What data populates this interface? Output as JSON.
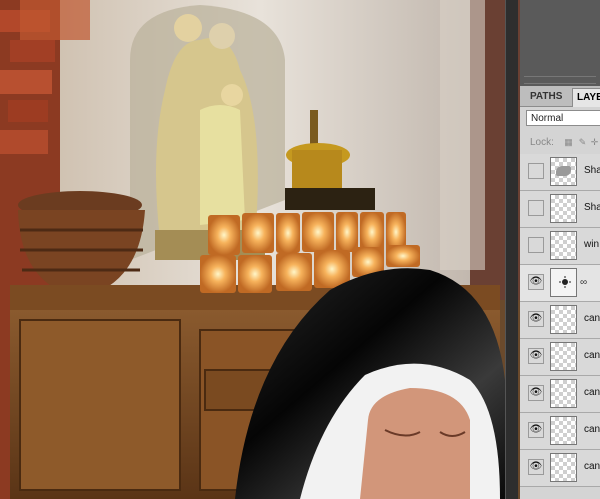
{
  "panel": {
    "tabs": [
      {
        "label": "PATHS",
        "active": false
      },
      {
        "label": "LAYE",
        "active": true
      }
    ],
    "blend_mode": "Normal",
    "lock_label": "Lock:",
    "layers": [
      {
        "name": "Sha",
        "visible": false,
        "thumb": "shadow"
      },
      {
        "name": "Sha",
        "visible": false,
        "thumb": "checker"
      },
      {
        "name": "win",
        "visible": false,
        "thumb": "checker"
      },
      {
        "name": "",
        "visible": true,
        "thumb": "adjustment",
        "selected": true
      },
      {
        "name": "can",
        "visible": true,
        "thumb": "checker"
      },
      {
        "name": "can",
        "visible": true,
        "thumb": "checker"
      },
      {
        "name": "can",
        "visible": true,
        "thumb": "checker"
      },
      {
        "name": "can",
        "visible": true,
        "thumb": "checker"
      },
      {
        "name": "can",
        "visible": true,
        "thumb": "checker"
      }
    ]
  },
  "icons": {
    "eye": "eye-icon",
    "link": "link-icon",
    "adjustment": "brightness-adjustment-icon",
    "lock": "lock-icon"
  },
  "colors": {
    "panel_bg": "#d4d4d4",
    "app_bg": "#5a5a5a",
    "candle_glow": "#f2a04a",
    "habit_black": "#111111"
  }
}
